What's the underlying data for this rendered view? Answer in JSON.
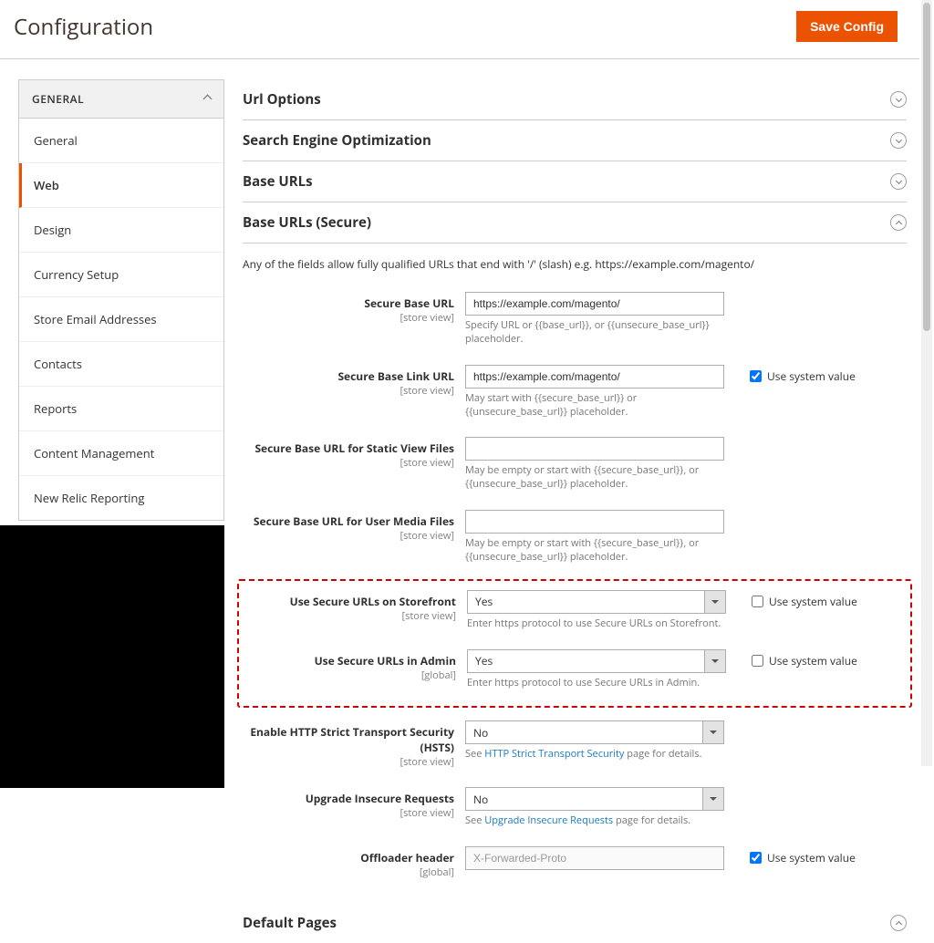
{
  "header": {
    "title": "Configuration",
    "save_label": "Save Config"
  },
  "sidebar": {
    "group": "GENERAL",
    "items": [
      {
        "label": "General"
      },
      {
        "label": "Web",
        "active": true
      },
      {
        "label": "Design"
      },
      {
        "label": "Currency Setup"
      },
      {
        "label": "Store Email Addresses"
      },
      {
        "label": "Contacts"
      },
      {
        "label": "Reports"
      },
      {
        "label": "Content Management"
      },
      {
        "label": "New Relic Reporting"
      }
    ]
  },
  "sections": {
    "url_options": "Url Options",
    "seo": "Search Engine Optimization",
    "base_urls": "Base URLs",
    "base_urls_secure": "Base URLs (Secure)",
    "default_pages": "Default Pages"
  },
  "secure": {
    "intro": "Any of the fields allow fully qualified URLs that end with '/' (slash) e.g. https://example.com/magento/",
    "base_url": {
      "label": "Secure Base URL",
      "scope": "[store view]",
      "value": "https://example.com/magento/",
      "note": "Specify URL or {{base_url}}, or {{unsecure_base_url}} placeholder."
    },
    "base_link_url": {
      "label": "Secure Base Link URL",
      "scope": "[store view]",
      "value": "https://example.com/magento/",
      "note": "May start with {{secure_base_url}} or {{unsecure_base_url}} placeholder.",
      "use_system": "Use system value",
      "checked": true
    },
    "static_url": {
      "label": "Secure Base URL for Static View Files",
      "scope": "[store view]",
      "value": "",
      "note": "May be empty or start with {{secure_base_url}}, or {{unsecure_base_url}} placeholder."
    },
    "media_url": {
      "label": "Secure Base URL for User Media Files",
      "scope": "[store view]",
      "value": "",
      "note": "May be empty or start with {{secure_base_url}}, or {{unsecure_base_url}} placeholder."
    },
    "storefront": {
      "label": "Use Secure URLs on Storefront",
      "scope": "[store view]",
      "value": "Yes",
      "note": "Enter https protocol to use Secure URLs on Storefront.",
      "use_system": "Use system value"
    },
    "admin": {
      "label": "Use Secure URLs in Admin",
      "scope": "[global]",
      "value": "Yes",
      "note": "Enter https protocol to use Secure URLs in Admin.",
      "use_system": "Use system value"
    },
    "hsts": {
      "label": "Enable HTTP Strict Transport Security (HSTS)",
      "scope": "[store view]",
      "value": "No",
      "note_pre": "See ",
      "link": "HTTP Strict Transport Security",
      "note_post": " page for details."
    },
    "upgrade": {
      "label": "Upgrade Insecure Requests",
      "scope": "[store view]",
      "value": "No",
      "note_pre": "See ",
      "link": "Upgrade Insecure Requests",
      "note_post": " page for details."
    },
    "offloader": {
      "label": "Offloader header",
      "scope": "[global]",
      "placeholder": "X-Forwarded-Proto",
      "use_system": "Use system value",
      "checked": true
    }
  }
}
